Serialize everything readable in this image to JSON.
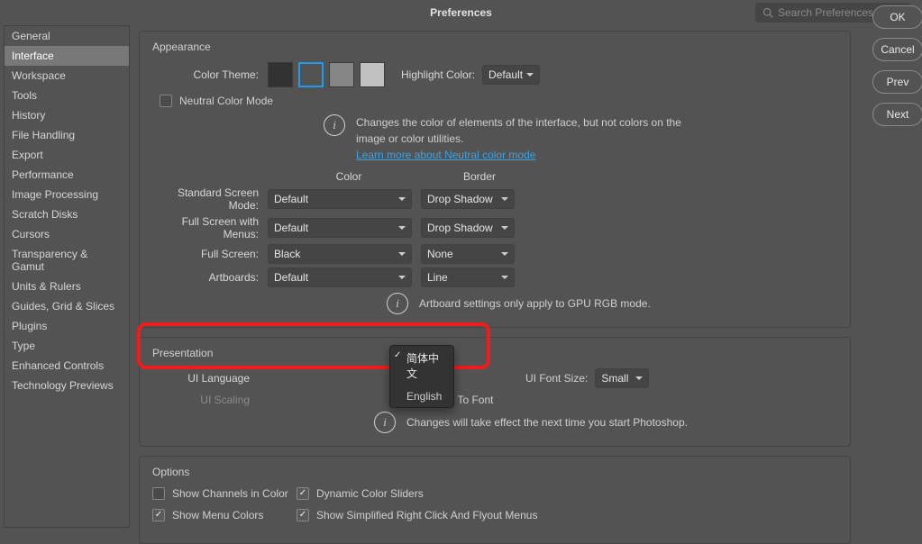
{
  "titlebar": {
    "title": "Preferences"
  },
  "search": {
    "placeholder": "Search Preferences"
  },
  "sidebar": {
    "items": [
      "General",
      "Interface",
      "Workspace",
      "Tools",
      "History",
      "File Handling",
      "Export",
      "Performance",
      "Image Processing",
      "Scratch Disks",
      "Cursors",
      "Transparency & Gamut",
      "Units & Rulers",
      "Guides, Grid & Slices",
      "Plugins",
      "Type",
      "Enhanced Controls",
      "Technology Previews"
    ],
    "selected_index": 1
  },
  "buttons": {
    "ok": "OK",
    "cancel": "Cancel",
    "prev": "Prev",
    "next": "Next"
  },
  "appearance": {
    "title": "Appearance",
    "color_theme_label": "Color Theme:",
    "highlight_color_label": "Highlight Color:",
    "highlight_color_value": "Default",
    "neutral_label": "Neutral Color Mode",
    "neutral_desc1": "Changes the color of elements of the interface, but not colors on the image or color utilities.",
    "neutral_link": "Learn more about Neutral color mode",
    "col_color": "Color",
    "col_border": "Border",
    "rows": [
      {
        "label": "Standard Screen Mode:",
        "color": "Default",
        "border": "Drop Shadow"
      },
      {
        "label": "Full Screen with Menus:",
        "color": "Default",
        "border": "Drop Shadow"
      },
      {
        "label": "Full Screen:",
        "color": "Black",
        "border": "None"
      },
      {
        "label": "Artboards:",
        "color": "Default",
        "border": "Line"
      }
    ],
    "artboard_note": "Artboard settings only apply to GPU RGB mode."
  },
  "presentation": {
    "title": "Presentation",
    "ui_language_label": "UI Language",
    "ui_language_menu": {
      "options": [
        "简体中文",
        "English"
      ],
      "selected_index": 0
    },
    "ui_scaling_label": "UI Scaling",
    "ui_font_size_label": "UI Font Size:",
    "ui_font_size_value": "Small",
    "scale_to_font_label": "Scale UI To Font",
    "changes_note": "Changes will take effect the next time you start Photoshop."
  },
  "options": {
    "title": "Options",
    "show_channels": "Show Channels in Color",
    "dynamic_sliders": "Dynamic Color Sliders",
    "show_menu_colors": "Show Menu Colors",
    "simplified_menus": "Show Simplified Right Click And Flyout Menus"
  }
}
